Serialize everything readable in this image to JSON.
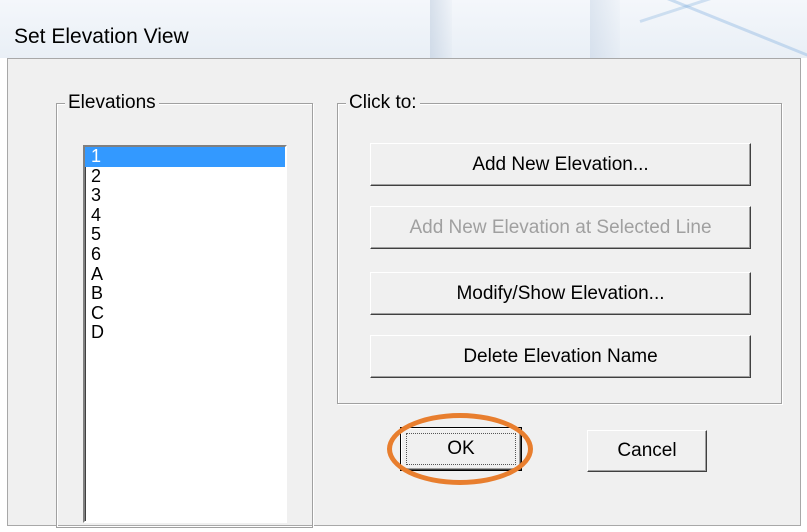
{
  "dialog": {
    "title": "Set Elevation View"
  },
  "elevations_group": {
    "legend": "Elevations",
    "items": [
      "1",
      "2",
      "3",
      "4",
      "5",
      "6",
      "A",
      "B",
      "C",
      "D"
    ],
    "selected": "1"
  },
  "actions_group": {
    "legend": "Click to:",
    "add_new": "Add New Elevation...",
    "add_at_line": "Add New Elevation at Selected Line",
    "modify_show": "Modify/Show Elevation...",
    "delete_name": "Delete Elevation Name"
  },
  "footer": {
    "ok": "OK",
    "cancel": "Cancel"
  },
  "colors": {
    "selection": "#3399ff",
    "highlight_ring": "#e87e2e"
  }
}
